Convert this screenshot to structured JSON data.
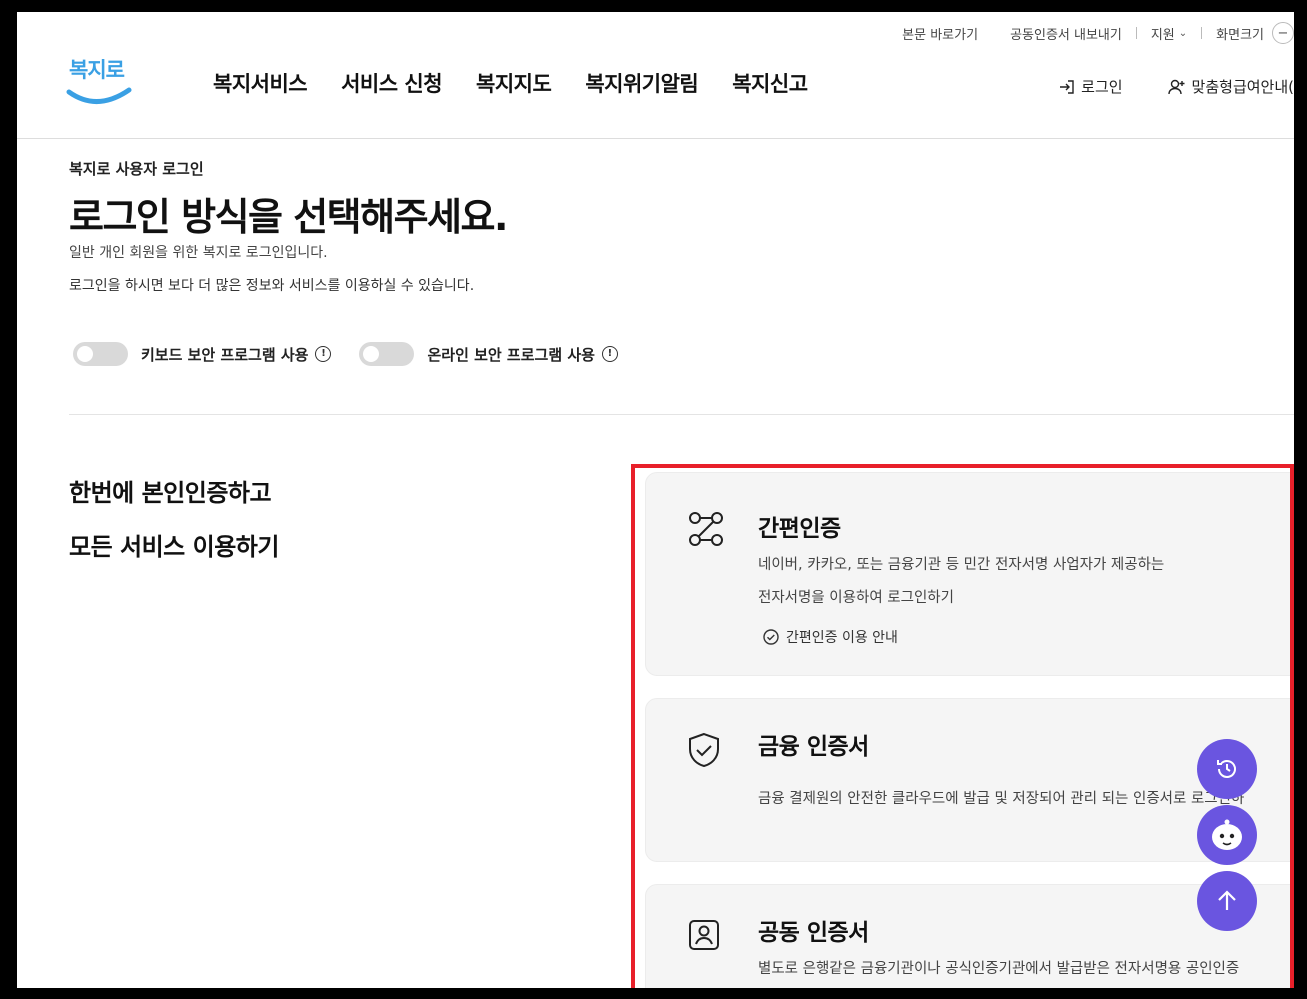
{
  "utility": {
    "skip_link": "본문 바로가기",
    "cert_export": "공동인증서 내보내기",
    "support": "지원",
    "font_size": "화면크기",
    "zoom_symbol": "−"
  },
  "logo": {
    "text": "복지로"
  },
  "nav": {
    "items": [
      {
        "label": "복지서비스"
      },
      {
        "label": "서비스 신청"
      },
      {
        "label": "복지지도"
      },
      {
        "label": "복지위기알림"
      },
      {
        "label": "복지신고"
      }
    ]
  },
  "header_right": {
    "login": "로그인",
    "custom_benefit": "맞춤형급여안내("
  },
  "page": {
    "breadcrumb": "복지로 사용자 로그인",
    "title": "로그인 방식을 선택해주세요.",
    "desc_1": "일반 개인 회원을 위한 복지로 로그인입니다.",
    "desc_2": "로그인을 하시면 보다 더 많은 정보와 서비스를 이용하실 수 있습니다."
  },
  "toggles": [
    {
      "label": "키보드 보안 프로그램 사용",
      "info": "!"
    },
    {
      "label": "온라인 보안 프로그램 사용",
      "info": "!"
    }
  ],
  "slogan": {
    "line_1": "한번에 본인인증하고",
    "line_2": "모든 서비스 이용하기"
  },
  "cards": {
    "simple_auth": {
      "title": "간편인증",
      "desc_1": "네이버, 카카오, 또는 금융기관 등 민간 전자서명 사업자가 제공하는",
      "desc_2": "전자서명을 이용하여 로그인하기",
      "guide": "간편인증 이용 안내"
    },
    "financial_cert": {
      "title": "금융 인증서",
      "desc_1": "금융 결제원의 안전한 클라우드에 발급 및 저장되어 관리 되는 인증서로 로그인하"
    },
    "joint_cert": {
      "title": "공동 인증서",
      "desc_1": "별도로 은행같은 금융기관이나 공식인증기관에서 발급받은 전자서명용 공인인증"
    }
  },
  "colors": {
    "accent": "#6a55e0",
    "highlight": "#e8202a",
    "logo_blue": "#3aa0e4",
    "card_bg": "#f5f5f5"
  }
}
